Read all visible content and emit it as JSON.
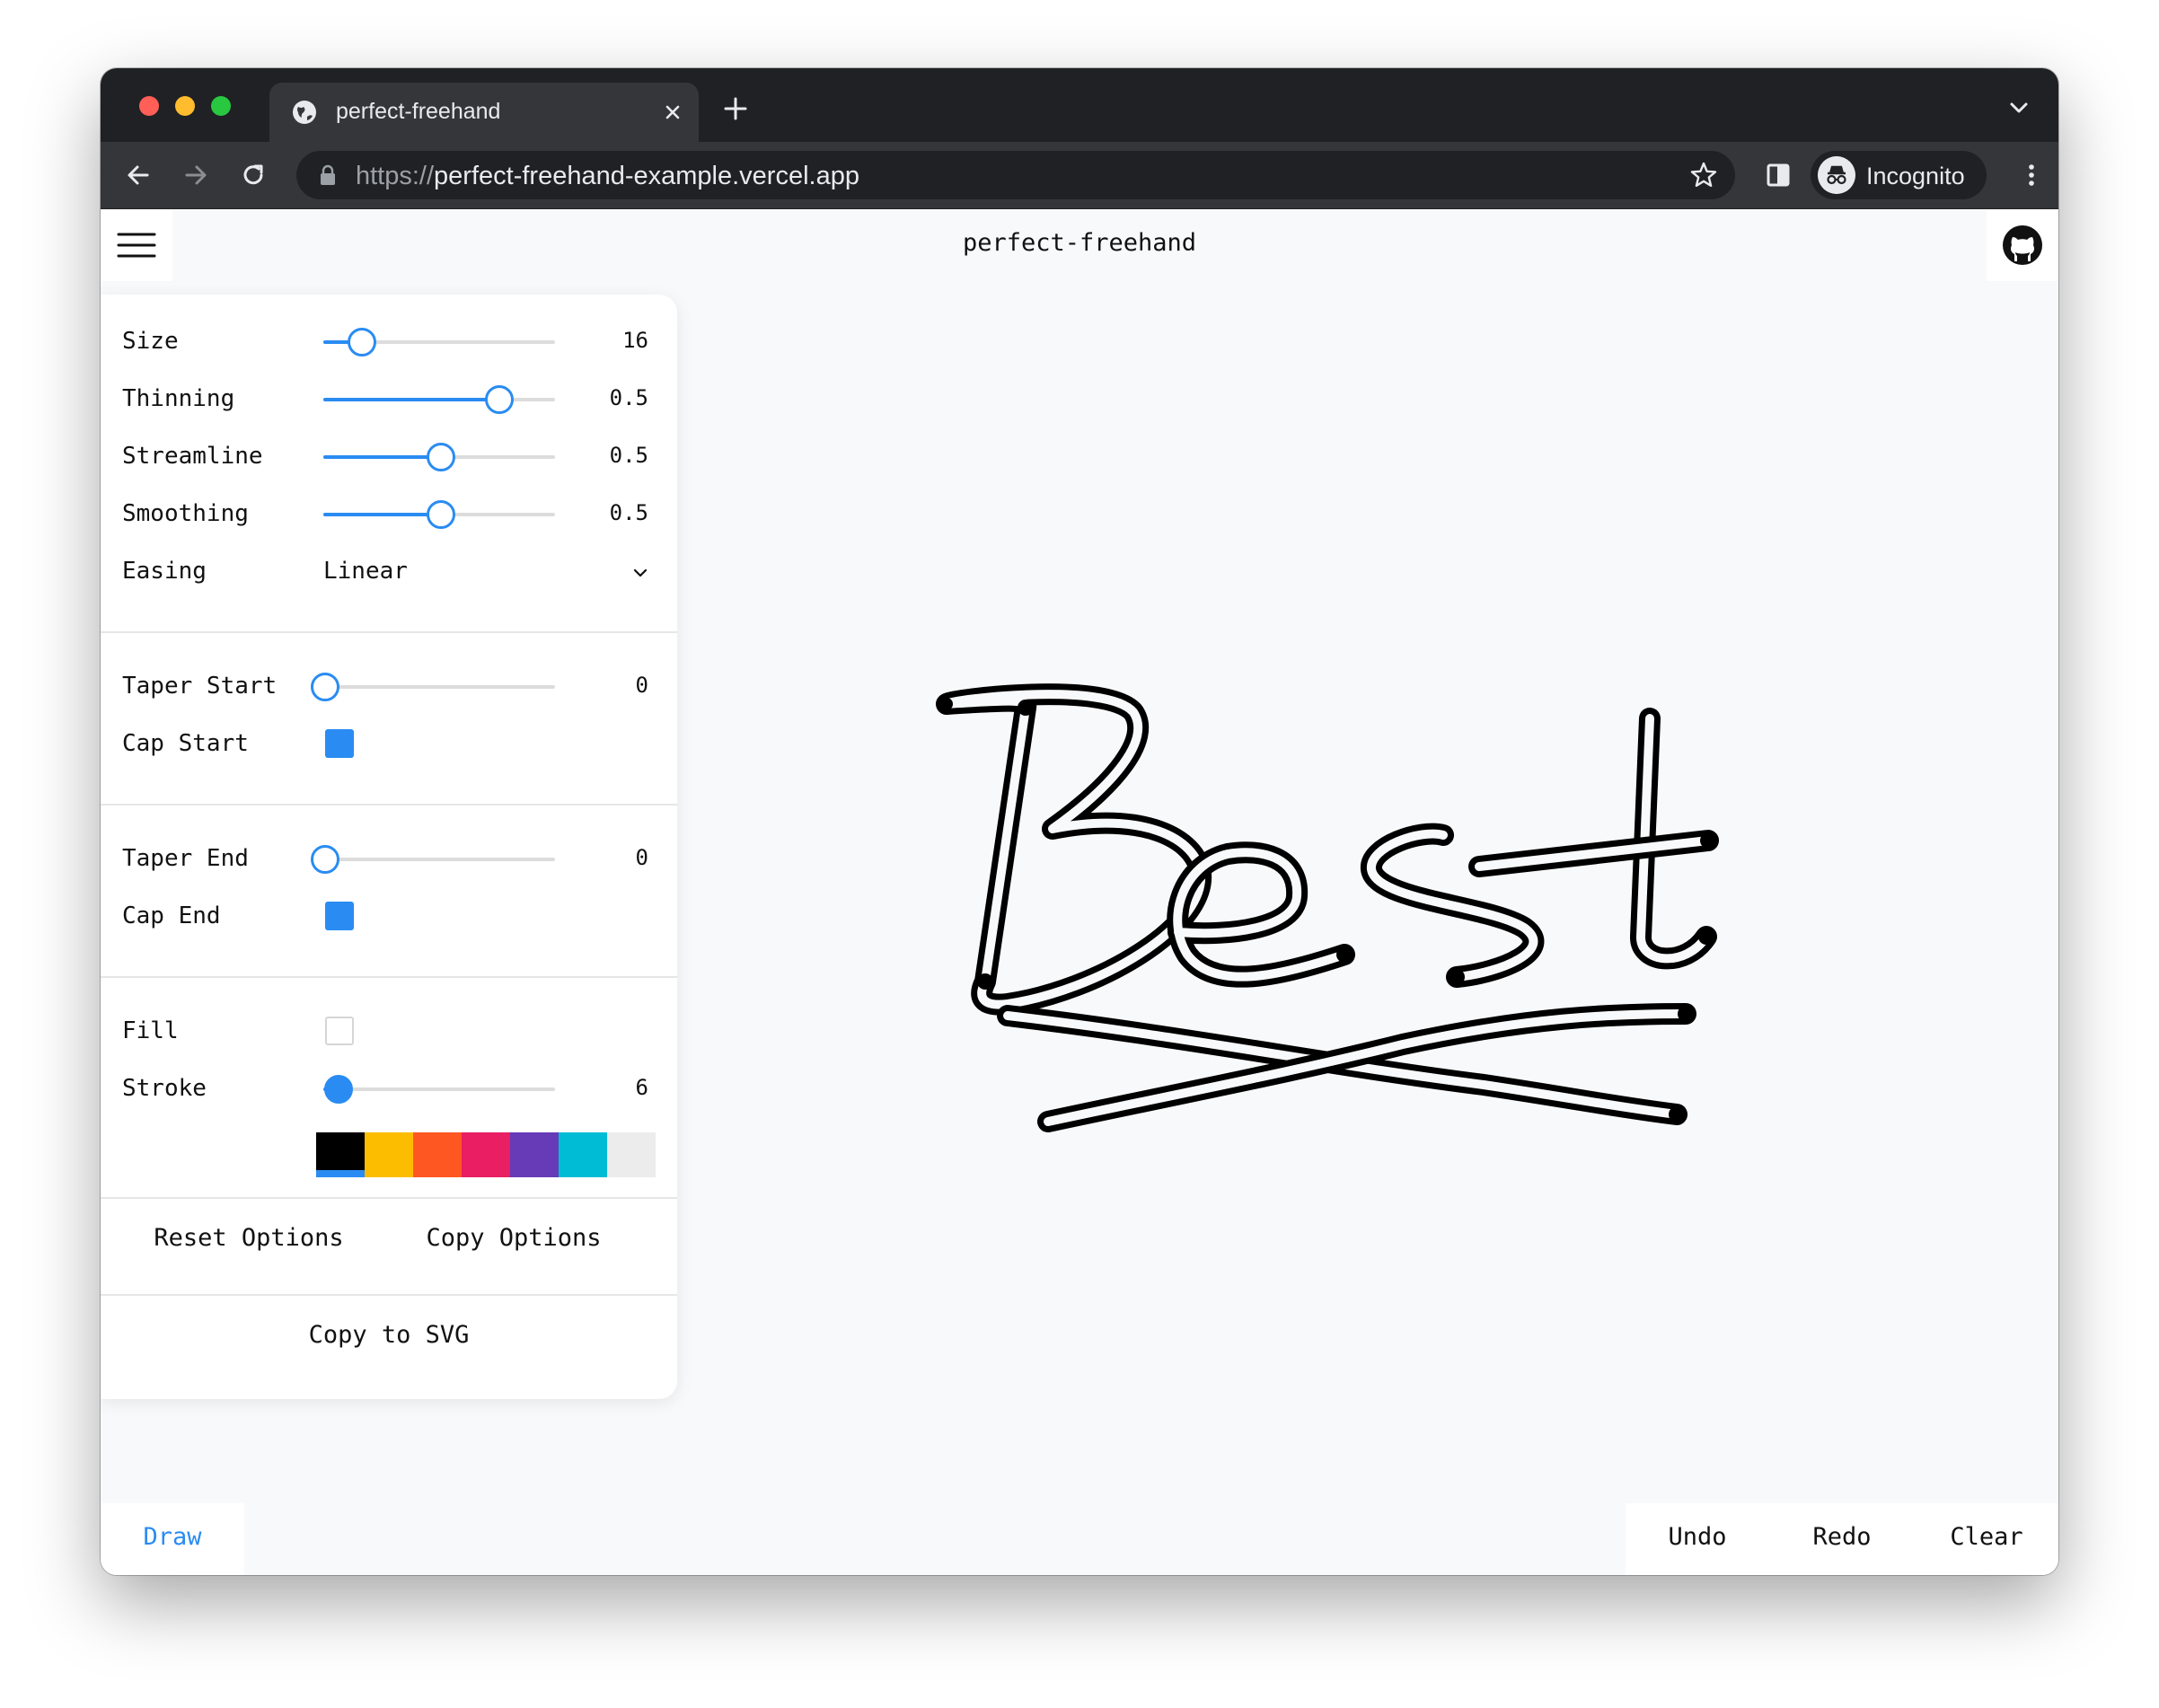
{
  "browser": {
    "tab_title": "perfect-freehand",
    "url_scheme": "https://",
    "url_host": "perfect-freehand-example.vercel.app",
    "profile_label": "Incognito",
    "traffic_colors": [
      "#ff5f57",
      "#febc2e",
      "#28c840"
    ]
  },
  "app": {
    "title": "perfect-freehand"
  },
  "controls": {
    "size": {
      "label": "Size",
      "value": "16",
      "fraction": 0.16
    },
    "thinning": {
      "label": "Thinning",
      "value": "0.5",
      "fraction": 0.75
    },
    "streamline": {
      "label": "Streamline",
      "value": "0.5",
      "fraction": 0.5
    },
    "smoothing": {
      "label": "Smoothing",
      "value": "0.5",
      "fraction": 0.5
    },
    "easing": {
      "label": "Easing",
      "value": "Linear"
    },
    "taper_start": {
      "label": "Taper Start",
      "value": "0",
      "fraction": 0
    },
    "cap_start": {
      "label": "Cap Start",
      "checked": true
    },
    "taper_end": {
      "label": "Taper End",
      "value": "0",
      "fraction": 0
    },
    "cap_end": {
      "label": "Cap End",
      "checked": true
    },
    "fill": {
      "label": "Fill",
      "checked": false
    },
    "stroke": {
      "label": "Stroke",
      "value": "6",
      "fraction": 0.06
    },
    "colors": [
      "#000000",
      "#fcbd01",
      "#ff5722",
      "#e91e63",
      "#673ab7",
      "#00bcd4",
      "#ececec"
    ],
    "selected_color_index": 0,
    "accent": "#2a8cf2"
  },
  "actions": {
    "reset_options": "Reset Options",
    "copy_options": "Copy Options",
    "copy_svg": "Copy to SVG"
  },
  "bottom": {
    "draw": "Draw",
    "undo": "Undo",
    "redo": "Redo",
    "clear": "Clear"
  }
}
